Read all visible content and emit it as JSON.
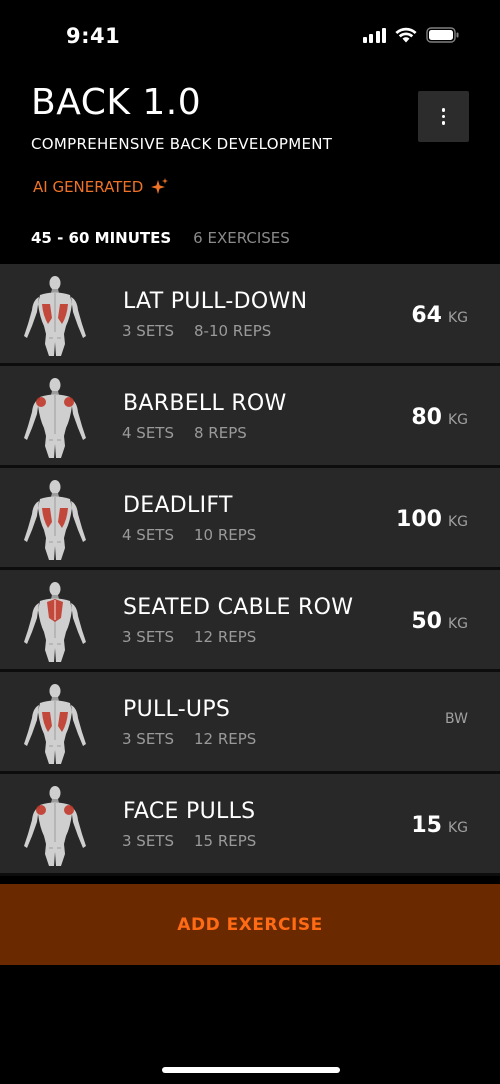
{
  "status": {
    "time": "9:41"
  },
  "header": {
    "title": "BACK 1.0",
    "subtitle": "COMPREHENSIVE BACK DEVELOPMENT",
    "ai_label": "AI GENERATED",
    "ai_icon": "sparkle-icon",
    "more_icon": "more-vertical-icon"
  },
  "meta": {
    "duration": "45 - 60 MINUTES",
    "exercise_count": "6 EXERCISES"
  },
  "exercises": [
    {
      "name": "LAT PULL-DOWN",
      "sets": "3 SETS",
      "reps": "8-10 REPS",
      "weight": "64",
      "unit": "KG",
      "highlight": "lats"
    },
    {
      "name": "BARBELL ROW",
      "sets": "4 SETS",
      "reps": "8 REPS",
      "weight": "80",
      "unit": "KG",
      "highlight": "rear-delts"
    },
    {
      "name": "DEADLIFT",
      "sets": "4 SETS",
      "reps": "10 REPS",
      "weight": "100",
      "unit": "KG",
      "highlight": "lats"
    },
    {
      "name": "SEATED CABLE ROW",
      "sets": "3 SETS",
      "reps": "12 REPS",
      "weight": "50",
      "unit": "KG",
      "highlight": "mid-back"
    },
    {
      "name": "PULL-UPS",
      "sets": "3 SETS",
      "reps": "12 REPS",
      "weight": "",
      "unit": "BW",
      "highlight": "lats"
    },
    {
      "name": "FACE PULLS",
      "sets": "3 SETS",
      "reps": "15 REPS",
      "weight": "15",
      "unit": "KG",
      "highlight": "rear-delts"
    }
  ],
  "add_button": {
    "label": "ADD EXERCISE"
  },
  "colors": {
    "accent": "#ee7227",
    "button_bg": "#6b2900",
    "row_bg": "#282828",
    "muscle": "#c0392b"
  }
}
